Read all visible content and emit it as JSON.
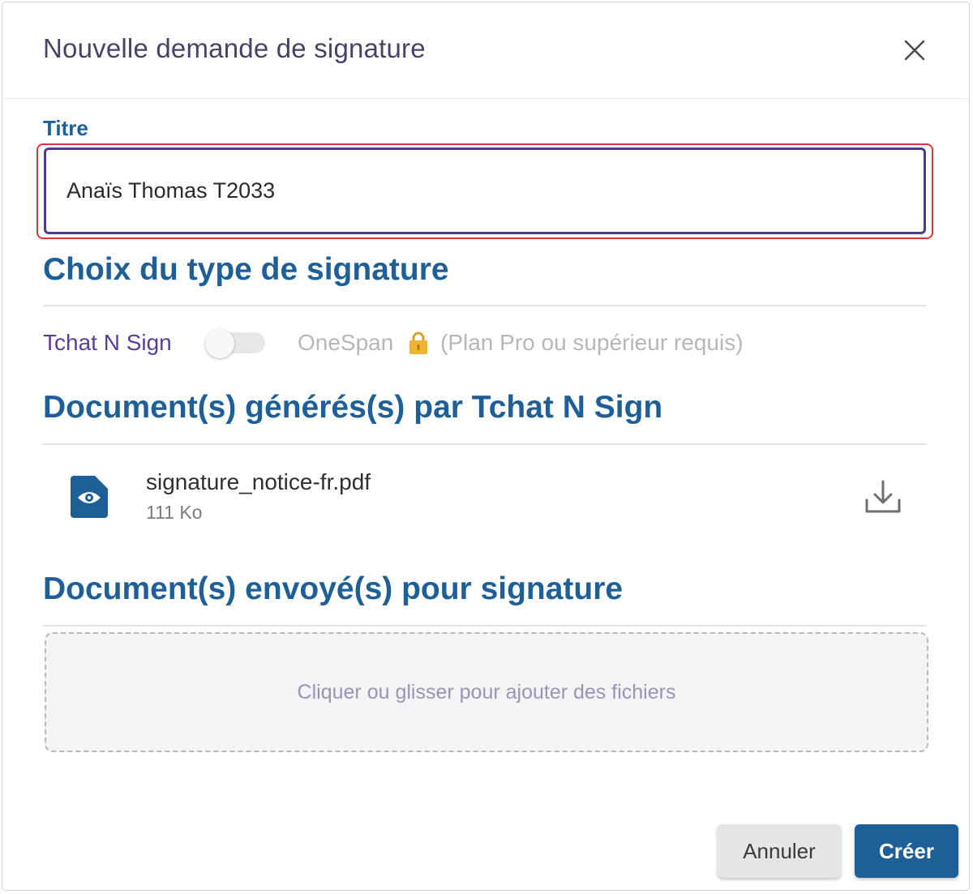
{
  "dialog": {
    "title": "Nouvelle demande de signature",
    "close_icon": "close-icon"
  },
  "title_field": {
    "label": "Titre",
    "value": "Anaïs Thomas T2033"
  },
  "signature_type": {
    "heading": "Choix du type de signature",
    "option_active": "Tchat N Sign",
    "toggle_on": false,
    "option_locked": "OneSpan",
    "lock_icon": "lock-icon",
    "locked_note": "(Plan Pro ou supérieur requis)"
  },
  "generated_docs": {
    "heading": "Document(s) générés(s) par Tchat N Sign",
    "files": [
      {
        "name": "signature_notice-fr.pdf",
        "size": "111 Ko",
        "icon": "file-eye-icon",
        "action_icon": "download-icon"
      }
    ]
  },
  "sent_docs": {
    "heading": "Document(s) envoyé(s) pour signature",
    "dropzone_text": "Cliquer ou glisser pour ajouter des fichiers"
  },
  "footer": {
    "cancel_label": "Annuler",
    "create_label": "Créer"
  },
  "colors": {
    "primary": "#1f5f98",
    "title_text": "#4a4266",
    "input_border": "#4f3b8c",
    "focus_ring": "#d9363e",
    "muted": "#b7b7bb"
  }
}
